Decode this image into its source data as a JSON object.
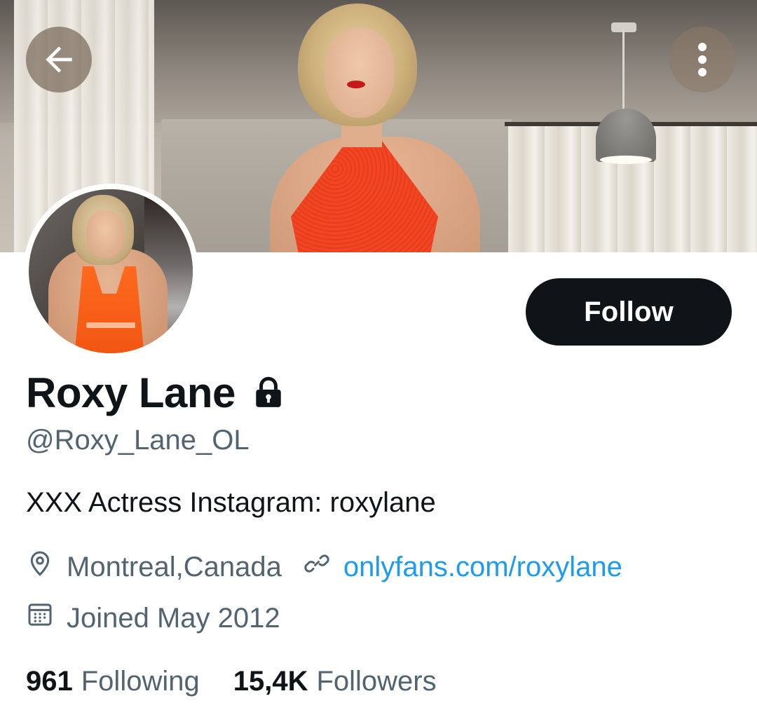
{
  "header": {
    "back_icon": "arrow-left-icon",
    "more_icon": "vertical-ellipsis-icon"
  },
  "banner": {
    "description_icon": "banner-photo"
  },
  "profile": {
    "display_name": "Roxy Lane",
    "protected_icon": "lock-icon",
    "handle": "@Roxy_Lane_OL",
    "bio": "XXX Actress Instagram: roxylane",
    "location": "Montreal,Canada",
    "location_icon": "location-pin-icon",
    "website": "onlyfans.com/roxylane",
    "website_icon": "link-icon",
    "joined": "Joined May 2012",
    "joined_icon": "calendar-icon"
  },
  "actions": {
    "follow_label": "Follow"
  },
  "stats": {
    "following_count": "961",
    "following_label": "Following",
    "followers_count": "15,4K",
    "followers_label": "Followers"
  },
  "colors": {
    "primary_text": "#0f1419",
    "secondary_text": "#536471",
    "link": "#1d9bf0",
    "follow_button_bg": "#0f1419",
    "follow_button_text": "#ffffff"
  }
}
